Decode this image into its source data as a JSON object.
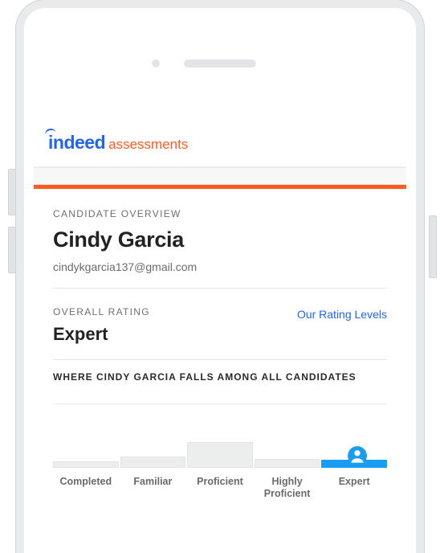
{
  "brand": {
    "name": "indeed",
    "product": "assessments"
  },
  "overview": {
    "label": "CANDIDATE OVERVIEW",
    "name": "Cindy Garcia",
    "email": "cindykgarcia137@gmail.com"
  },
  "rating": {
    "label": "OVERALL RATING",
    "value": "Expert",
    "link": "Our Rating Levels"
  },
  "distribution": {
    "title": "WHERE CINDY GARCIA FALLS AMONG ALL CANDIDATES",
    "highlighted_index": 4,
    "levels": [
      {
        "label": "Completed"
      },
      {
        "label": "Familiar"
      },
      {
        "label": "Proficient"
      },
      {
        "label": "Highly Proficient"
      },
      {
        "label": "Expert"
      }
    ]
  },
  "colors": {
    "accent": "#ff5a1f",
    "brand_blue": "#2164f3",
    "highlight": "#1a9cf3"
  },
  "chart_data": {
    "type": "bar",
    "categories": [
      "Completed",
      "Familiar",
      "Proficient",
      "Highly Proficient",
      "Expert"
    ],
    "values": [
      10,
      18,
      40,
      14,
      10
    ],
    "title": "WHERE CINDY GARCIA FALLS AMONG ALL CANDIDATES",
    "xlabel": "",
    "ylabel": "",
    "ylim": [
      0,
      100
    ],
    "highlighted_category": "Expert"
  }
}
